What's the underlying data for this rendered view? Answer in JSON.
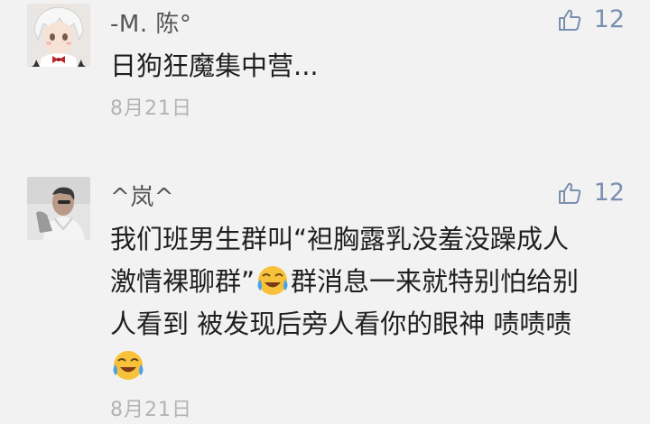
{
  "comments": [
    {
      "author": "-M. 陈°",
      "likes": "12",
      "text_lines": [
        "日狗狂魔集中营..."
      ],
      "date": "8月21日",
      "avatar_icon": "anime-character-avatar-icon"
    },
    {
      "author": "^岚^",
      "likes": "12",
      "text_lines": [
        "我们班男生群叫“袒胸露乳没羞没躁成人",
        "激情裸聊群”",
        "群消息一来就特别怕给别",
        "人看到 被发现后旁人看你的眼神 啧啧啧"
      ],
      "date": "8月21日",
      "avatar_icon": "photo-person-avatar-icon",
      "emoji_icon": "crying-laughing-emoji-icon"
    }
  ],
  "like_icon": "thumbs-up-icon",
  "colors": {
    "background": "#f2f2f2",
    "like": "#7a8fb0",
    "date": "#b3b3b3"
  }
}
